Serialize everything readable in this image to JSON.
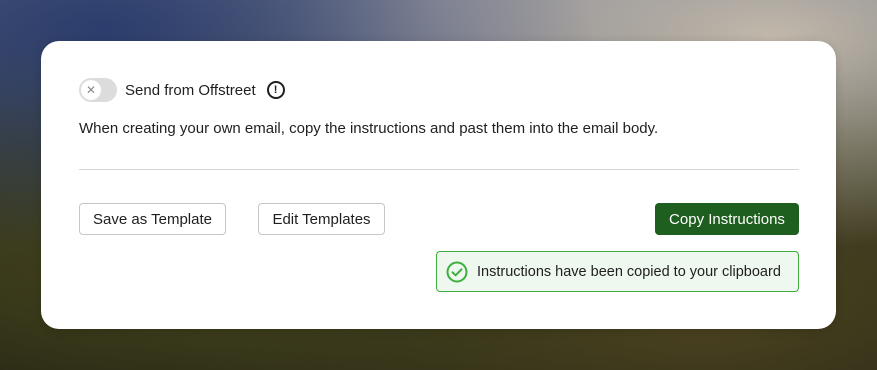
{
  "settings": {
    "toggle_label": "Send from Offstreet",
    "toggle_state": "off",
    "description": "When creating your own email, copy the instructions and past them into the email body."
  },
  "icons": {
    "toggle_knob": "close-icon",
    "info": "alert-circle-icon",
    "toast": "check-circle-icon"
  },
  "actions": {
    "save_template": "Save as Template",
    "edit_templates": "Edit Templates",
    "copy_instructions": "Copy Instructions"
  },
  "toast": {
    "message": "Instructions have been copied to your clipboard"
  },
  "colors": {
    "primary": "#1e5e1e",
    "success_border": "#3fae3f",
    "success_bg": "#eef8ee"
  }
}
